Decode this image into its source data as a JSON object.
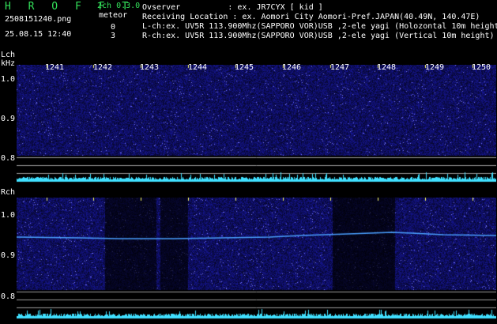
{
  "header": {
    "app_title": "H R O F F T",
    "version": "2ch 0.3.0",
    "filename": "2508151240.png",
    "meteor_label": "meteor",
    "datetime": "25.08.15 12:40",
    "lch_count": "0",
    "rch_count": "3"
  },
  "info": {
    "observer": "Ovserver          : ex. JR7CYX [ kid ]",
    "location": "Receiving Location : ex. Aomori City Aomori-Pref.JAPAN(40.49N, 140.47E)",
    "lch": "L-ch:ex. UV5R 113.900Mhz(SAPPORO VOR)USB ,2-ele yagi (Holozontal 10m height)",
    "rch": "R-ch:ex. UV5R 113.900Mhz(SAPPORO VOR)USB ,2-ele yagi (Vertical 10m height)"
  },
  "axis": {
    "lch_label": "Lch",
    "khz_label": "kHz",
    "rch_label": "Rch",
    "time_ticks": [
      "1241",
      "1242",
      "1243",
      "1244",
      "1245",
      "1246",
      "1247",
      "1248",
      "1249",
      "1250"
    ],
    "lch_y_ticks": [
      "1.0",
      "0.9",
      "0.8"
    ],
    "rch_y_ticks": [
      "1.0",
      "0.9",
      "0.8"
    ]
  },
  "colors": {
    "background": "#000000",
    "title_green": "#33e05a",
    "spectrum_blue": "#2020a0",
    "signal_line": "#4aa0ff",
    "baseline_cyan": "#40e0ff"
  }
}
